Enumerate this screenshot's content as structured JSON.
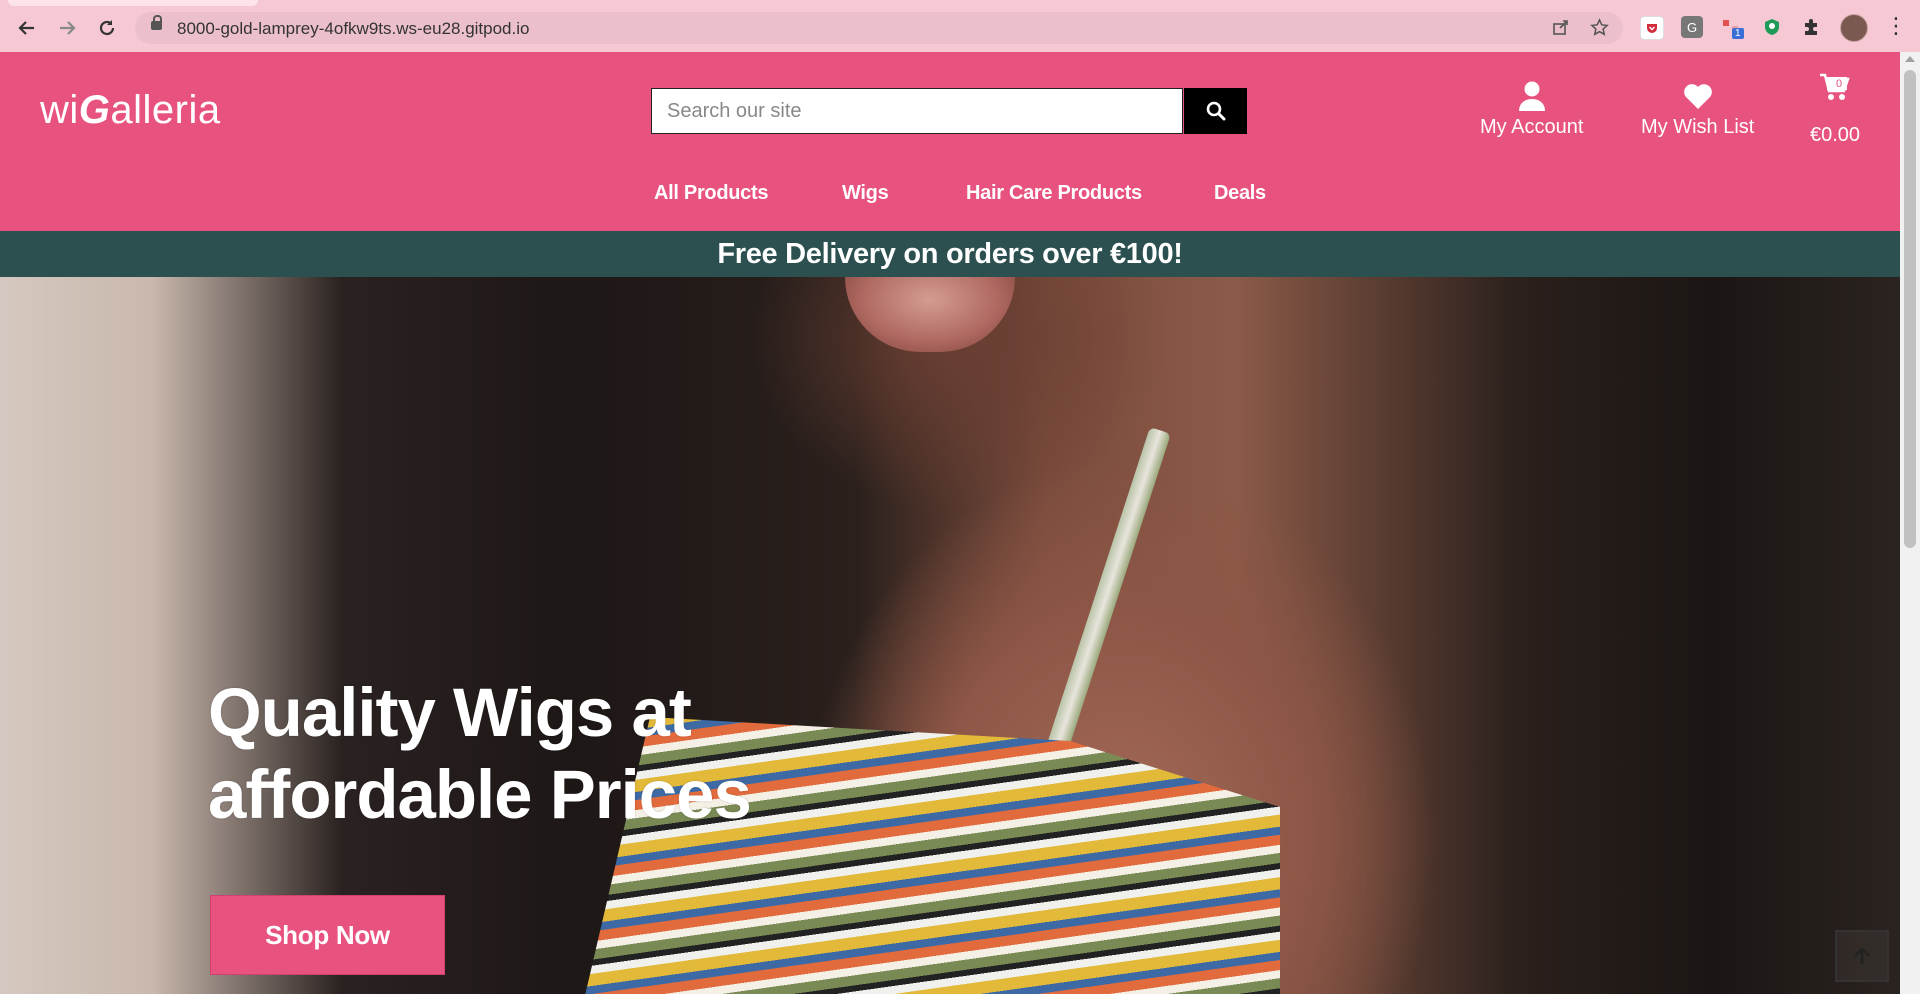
{
  "browser": {
    "url": "8000-gold-lamprey-4ofkw9ts.ws-eu28.gitpod.io",
    "extension_badge": "1"
  },
  "header": {
    "logo_prefix": "wi",
    "logo_g": "G",
    "logo_suffix": "alleria",
    "search_placeholder": "Search our site",
    "my_account_label": "My Account",
    "wishlist_label": "My Wish List",
    "cart_total": "€0.00",
    "cart_count": "0"
  },
  "nav": {
    "items": [
      "All Products",
      "Wigs",
      "Hair Care Products",
      "Deals"
    ]
  },
  "banner": {
    "text": "Free Delivery on orders over €100!"
  },
  "hero": {
    "title_line1": "Quality Wigs at",
    "title_line2": "affordable Prices",
    "cta_label": "Shop Now"
  },
  "colors": {
    "brand_pink": "#e8527e",
    "banner_teal": "#2c4f4f"
  }
}
